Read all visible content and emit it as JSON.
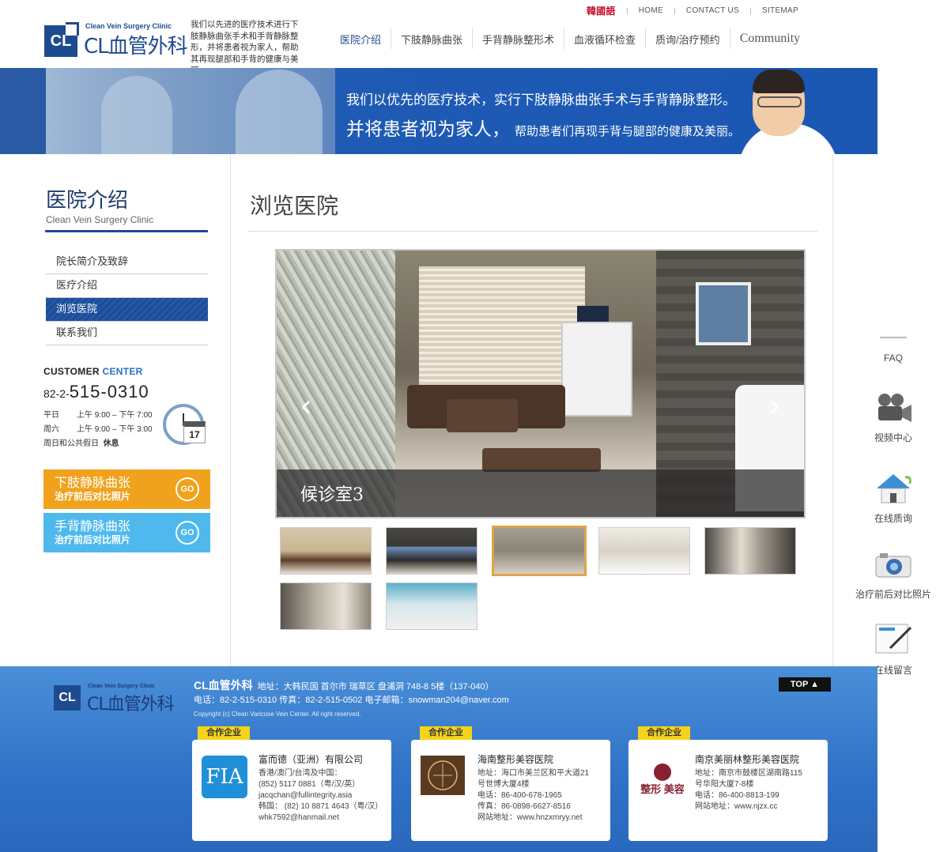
{
  "header": {
    "util_links": [
      "韓國語",
      "HOME",
      "CONTACT US",
      "SITEMAP"
    ],
    "logo_en": "Clean Vein Surgery Clinic",
    "logo_cl": "CL",
    "logo_zh": "CL血管外科",
    "slogan": "我们以先进的医疗技术进行下肢静脉曲张手术和手背静脉整形，并将患者视为家人，帮助其再现腿部和手背的健康与美丽。",
    "nav": [
      "医院介绍",
      "下肢静脉曲张",
      "手背静脉整形术",
      "血液循环检查",
      "质询/治疗预约",
      "Community"
    ]
  },
  "banner": {
    "line1": "我们以优先的医疗技术，实行下肢静脉曲张手术与手背静脉整形。",
    "line2_big": "并将患者视为家人，",
    "line2_small": "帮助患者们再现手背与腿部的健康及美丽。"
  },
  "sidebar": {
    "title": "医院介绍",
    "subtitle": "Clean Vein Surgery Clinic",
    "menu": [
      "院长简介及致辞",
      "医疗介绍",
      "浏览医院",
      "联系我们"
    ],
    "active_index": 2,
    "cc_title_a": "CUSTOMER ",
    "cc_title_b": "CENTER",
    "cc_prefix": "82-2-",
    "cc_number": "515-0310",
    "hours": [
      {
        "label": "平日",
        "value": "上午 9:00 – 下午 7:00"
      },
      {
        "label": "周六",
        "value": "上午 9:00 – 下午 3:00"
      },
      {
        "label": "周日和公共假日",
        "value": "休息"
      }
    ],
    "calendar_day": "17",
    "promo1": {
      "title": "下肢静脉曲张",
      "sub": "治疗前后对比照片",
      "go": "GO"
    },
    "promo2": {
      "title": "手背静脉曲张",
      "sub": "治疗前后对比照片",
      "go": "GO"
    }
  },
  "content": {
    "page_title": "浏览医院",
    "caption": "候诊室3",
    "prev_icon": "chevron-left-icon",
    "next_icon": "chevron-right-icon",
    "thumb_selected_index": 2
  },
  "quickmenu": [
    "FAQ",
    "视频中心",
    "在线质询",
    "治疗前后对比照片",
    "在线留言"
  ],
  "footer": {
    "logo_en": "Clean Vein Surgery Clinic",
    "logo_cl": "CL",
    "logo_zh": "CL血管外科",
    "name": "CL血管外科",
    "address": "地址：大韩民国 首尔市 瑞草区 盘浦洞 748-8 5楼（137-040）",
    "contact": "电话：82-2-515-0310  传真：82-2-515-0502  电子邮箱：snowman204@naver.com",
    "copyright": "Copyright (c) Clean Varicose Vein Center. All right reserved.",
    "top": "TOP ▲",
    "partner_tag": "合作企业",
    "partners": [
      {
        "name": "富而德（亚洲）有限公司",
        "logo": "FIA",
        "lines": [
          "香港/澳门/台湾及中国：",
          "(852) 5117 0881（粤/汉/英）",
          "jacqchan@fullintegrity.asia",
          "韩国： (82) 10 8871 4643（粤/汉）",
          "whk7592@hanmail.net"
        ]
      },
      {
        "name": "海南整形美容医院",
        "logo": "",
        "lines": [
          "地址：海口市美兰区和平大道21",
          "号世博大厦4楼",
          "电话：86-400-678-1965",
          "传真：86-0898-6627-8516",
          "网站地址：www.hnzxmryy.net"
        ]
      },
      {
        "name": "南京美丽林整形美容医院",
        "logo": "整形  美容",
        "lines": [
          "地址：南京市鼓楼区湖南路115",
          "号华阳大厦7-8楼",
          "电话：86-400-8813-199",
          "网站地址：www.njzx.cc"
        ]
      }
    ]
  }
}
